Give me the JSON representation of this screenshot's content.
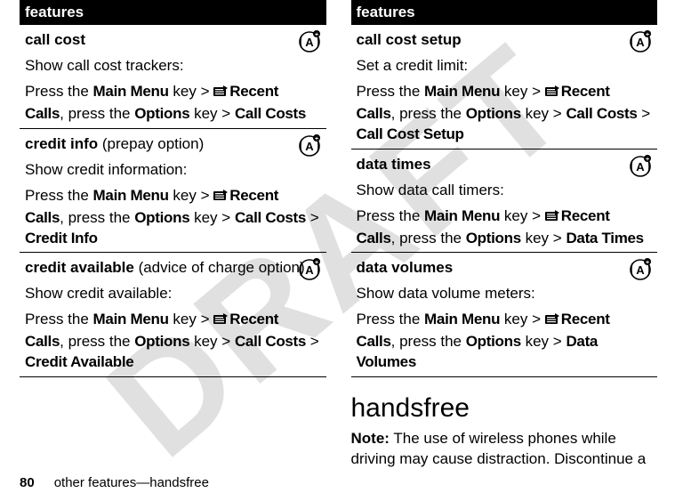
{
  "watermark": "DRAFT",
  "left": {
    "header": "features",
    "rows": [
      {
        "title": "call cost",
        "subtitle_suffix": "",
        "desc": "Show call cost trackers:",
        "path_prefix": "Press the ",
        "k1": "Main Menu",
        "k1_after": " key > ",
        "k2": "Recent Calls",
        "k2_after": ", press the ",
        "k3": "Options",
        "k3_after": " key > ",
        "k4": "Call Costs",
        "k4_after": "",
        "k5": "",
        "k5_sep": ""
      },
      {
        "title": "credit info",
        "subtitle_suffix": " (prepay option)",
        "desc": "Show credit information:",
        "path_prefix": "Press the ",
        "k1": "Main Menu",
        "k1_after": " key > ",
        "k2": "Recent Calls",
        "k2_after": ", press the ",
        "k3": "Options",
        "k3_after": " key > ",
        "k4": "Call Costs",
        "k4_after": " > ",
        "k5": "Credit Info",
        "k5_sep": ""
      },
      {
        "title": "credit available",
        "subtitle_suffix": " (advice of charge option)",
        "desc": "Show credit available:",
        "path_prefix": "Press the ",
        "k1": "Main Menu",
        "k1_after": " key > ",
        "k2": "Recent Calls",
        "k2_after": ", press the ",
        "k3": "Options",
        "k3_after": " key > ",
        "k4": "Call Costs",
        "k4_after": " > ",
        "k5": "Credit Available",
        "k5_sep": ""
      }
    ]
  },
  "right": {
    "header": "features",
    "rows": [
      {
        "title": "call cost setup",
        "subtitle_suffix": "",
        "desc": "Set a credit limit:",
        "path_prefix": "Press the ",
        "k1": "Main Menu",
        "k1_after": " key > ",
        "k2": "Recent Calls",
        "k2_after": ", press the ",
        "k3": "Options",
        "k3_after": " key > ",
        "k4": "Call Costs",
        "k4_after": " > ",
        "k5": "Call Cost Setup",
        "k5_sep": ""
      },
      {
        "title": "data times",
        "subtitle_suffix": "",
        "desc": "Show data call timers:",
        "path_prefix": "Press the ",
        "k1": "Main Menu",
        "k1_after": " key > ",
        "k2": "Recent Calls",
        "k2_after": ", press the ",
        "k3": "Options",
        "k3_after": " key > ",
        "k4": "Data Times",
        "k4_after": "",
        "k5": "",
        "k5_sep": ""
      },
      {
        "title": "data volumes",
        "subtitle_suffix": "",
        "desc": "Show data volume meters:",
        "path_prefix": "Press the ",
        "k1": "Main Menu",
        "k1_after": " key > ",
        "k2": "Recent Calls",
        "k2_after": ", press the ",
        "k3": "Options",
        "k3_after": " key > ",
        "k4": "Data Volumes",
        "k4_after": "",
        "k5": "",
        "k5_sep": ""
      }
    ]
  },
  "section_heading": "handsfree",
  "note_label": "Note:",
  "note_text": " The use of wireless phones while driving may cause distraction.  Discontinue a",
  "footer": {
    "pagenum": "80",
    "text": "other features—handsfree"
  }
}
